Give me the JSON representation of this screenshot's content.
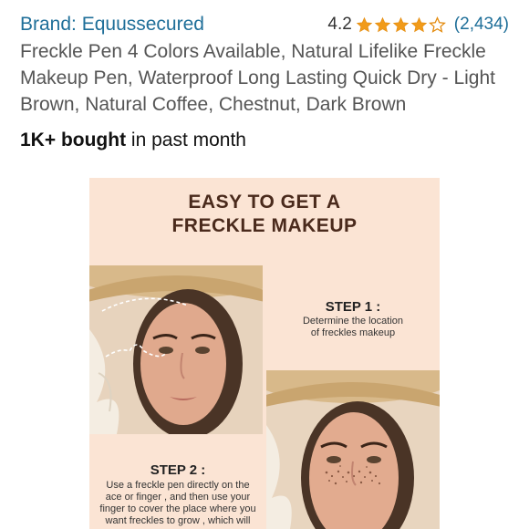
{
  "header": {
    "brand_link": "Brand: Equussecured",
    "rating_value": "4.2",
    "rating_count": "(2,434)",
    "stars": {
      "rating": 4.2,
      "max": 5,
      "color": "#f19b1a"
    }
  },
  "product": {
    "title": "Freckle Pen 4 Colors Available, Natural Lifelike Freckle Makeup Pen, Waterproof Long Lasting Quick Dry - Light Brown, Natural Coffee, Chestnut, Dark Brown",
    "bought_bold": "1K+ bought",
    "bought_rest": " in past month"
  },
  "image": {
    "headline_line1": "EASY TO GET A",
    "headline_line2": "FRECKLE MAKEUP",
    "step1_title": "STEP 1 :",
    "step1_desc_line1": "Determine the location",
    "step1_desc_line2": "of freckles makeup",
    "step2_title": "STEP 2 :",
    "step2_desc_line1": "Use a freckle pen directly on the",
    "step2_desc_line2": "ace or finger , and then use your",
    "step2_desc_line3": "finger to cover the place where you",
    "step2_desc_line4": "want freckles to grow , which will",
    "background_color": "#fbe4d4",
    "headline_color": "#4a2a1c"
  },
  "colors": {
    "link": "#1f6f99",
    "title_text": "#555555",
    "star": "#f19b1a"
  }
}
